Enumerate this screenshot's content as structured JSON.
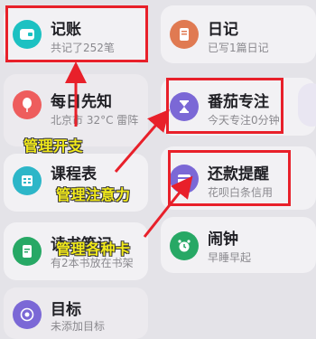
{
  "cards": {
    "accounting": {
      "title": "记账",
      "subtitle": "共记了252笔",
      "icon": "wallet-icon",
      "color": "#1cc1c2"
    },
    "diary": {
      "title": "日记",
      "subtitle": "已写1篇日记",
      "icon": "notebook-icon",
      "color": "#e07a52"
    },
    "daily_news": {
      "title": "每日先知",
      "subtitle": "北京市 32°C 雷阵",
      "icon": "balloon-icon",
      "color": "#ee5d5d"
    },
    "pomodoro": {
      "title": "番茄专注",
      "subtitle": "今天专注0分钟",
      "icon": "hourglass-icon",
      "color": "#7b68d6"
    },
    "timetable": {
      "title": "课程表",
      "subtitle": "",
      "icon": "calendar-grid-icon",
      "color": "#2db6c8"
    },
    "repayment": {
      "title": "还款提醒",
      "subtitle": "花呗白条信用",
      "icon": "credit-card-icon",
      "color": "#7b68d6"
    },
    "reading_notes": {
      "title": "读书笔记",
      "subtitle": "有2本书放在书架",
      "icon": "book-notes-icon",
      "color": "#27a865"
    },
    "alarm": {
      "title": "闹钟",
      "subtitle": "早睡早起",
      "icon": "alarm-clock-icon",
      "color": "#27a865"
    },
    "goal": {
      "title": "目标",
      "subtitle": "未添加目标",
      "icon": "target-icon",
      "color": "#7b68d6"
    }
  },
  "annotations": {
    "manage_expenses": "管理开支",
    "manage_attention": "管理注意力",
    "manage_cards": "管理各种卡"
  },
  "colors": {
    "highlight": "#e8202a",
    "annotation_text": "#f2ea1a"
  }
}
